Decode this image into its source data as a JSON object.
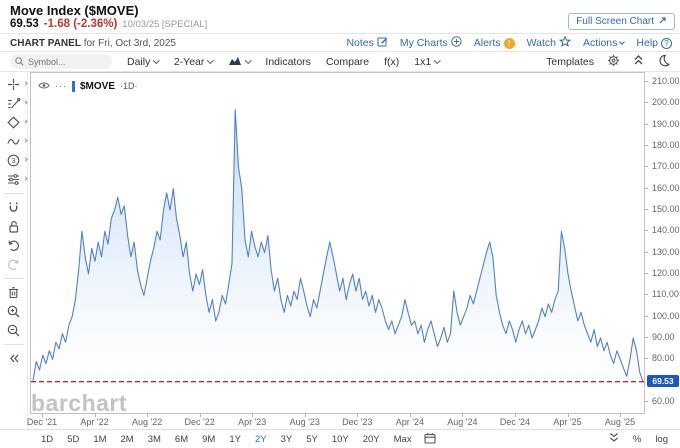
{
  "header": {
    "title": "Move Index ($MOVE)",
    "quote": {
      "last": "69.53",
      "change": "-1.68 (-2.36%)",
      "date": "10/03/25 [SPECIAL]"
    },
    "fullscreen_button": "Full Screen Chart",
    "panel_label": "CHART PANEL",
    "panel_date": "for Fri, Oct 3rd, 2025",
    "links": [
      {
        "label": "Notes",
        "icon": "edit-note-icon"
      },
      {
        "label": "My Charts",
        "icon": "circle-plus-icon"
      },
      {
        "label": "Alerts",
        "icon": "alert-badge-icon"
      },
      {
        "label": "Watch",
        "icon": "star-icon"
      },
      {
        "label": "Actions",
        "icon": "caret-down-icon"
      },
      {
        "label": "Help",
        "icon": "question-circle-icon"
      }
    ]
  },
  "toolbar": {
    "symbol_placeholder": "Symbol...",
    "period_label": "Daily",
    "range_label": "2-Year",
    "chart_type_icon": "area-chart-icon",
    "items": [
      "Indicators",
      "Compare",
      "f(x)",
      "1x1"
    ],
    "templates_label": "Templates",
    "right_icons": [
      "gear-icon",
      "collapse-up-icon",
      "moon-icon"
    ]
  },
  "sidebar_tools": [
    "cursor-crosshair",
    "trend-line",
    "shapes",
    "wave",
    "annotation-3",
    "sliders",
    "magnet",
    "unlock",
    "undo",
    "redo",
    "trash",
    "zoom-in",
    "zoom-out",
    "collapse-left"
  ],
  "chart": {
    "legend_symbol": "$MOVE",
    "legend_period": "·1D·",
    "last_price_badge": "69.53",
    "watermark": "barchart"
  },
  "chart_data": {
    "type": "area",
    "title": "Move Index ($MOVE), Daily, 2-Year view ending Fri Oct 3rd 2025",
    "symbol": "$MOVE",
    "timeframe": "Daily",
    "range": "2-Year",
    "x_start": "Dec 2021",
    "x_end": "Oct 3, 2025",
    "x_tick_labels": [
      "Dec '21",
      "Apr '22",
      "Aug '22",
      "Dec '22",
      "Apr '23",
      "Aug '23",
      "Dec '23",
      "Apr '24",
      "Aug '24",
      "Dec '24",
      "Apr '25",
      "Aug '25"
    ],
    "y_ticks": [
      210,
      200,
      190,
      180,
      170,
      160,
      150,
      140,
      130,
      120,
      110,
      100,
      90,
      80,
      60
    ],
    "ylim": [
      55,
      215
    ],
    "grid": false,
    "legend_position": "top-left",
    "last_value": 69.53,
    "reference_line": {
      "value": 69.53,
      "style": "dashed",
      "color": "#cc2b2b"
    },
    "values": [
      70,
      79,
      75,
      82,
      78,
      84,
      80,
      88,
      85,
      92,
      88,
      96,
      100,
      108,
      122,
      140,
      128,
      120,
      132,
      126,
      135,
      128,
      140,
      134,
      146,
      150,
      156,
      148,
      152,
      138,
      128,
      135,
      122,
      115,
      110,
      118,
      126,
      132,
      140,
      136,
      150,
      158,
      150,
      160,
      146,
      138,
      128,
      135,
      120,
      112,
      120,
      115,
      122,
      110,
      102,
      108,
      98,
      102,
      110,
      106,
      115,
      125,
      197,
      170,
      160,
      136,
      128,
      140,
      133,
      128,
      135,
      130,
      138,
      122,
      112,
      118,
      108,
      102,
      110,
      105,
      112,
      108,
      118,
      112,
      105,
      100,
      108,
      104,
      112,
      120,
      128,
      135,
      128,
      120,
      112,
      118,
      108,
      115,
      120,
      112,
      118,
      108,
      112,
      105,
      110,
      102,
      108,
      104,
      98,
      94,
      98,
      92,
      96,
      100,
      108,
      102,
      96,
      98,
      92,
      96,
      88,
      94,
      98,
      92,
      86,
      90,
      95,
      88,
      92,
      112,
      102,
      96,
      100,
      104,
      110,
      106,
      112,
      118,
      124,
      130,
      135,
      128,
      110,
      102,
      96,
      92,
      98,
      94,
      88,
      94,
      98,
      92,
      96,
      90,
      94,
      98,
      104,
      100,
      106,
      102,
      108,
      112,
      140,
      132,
      120,
      112,
      105,
      98,
      102,
      96,
      92,
      88,
      94,
      86,
      90,
      84,
      88,
      82,
      78,
      84,
      80,
      76,
      72,
      80,
      90,
      84,
      74,
      69.53
    ]
  },
  "bottom_bar": {
    "ranges": [
      "1D",
      "5D",
      "1M",
      "2M",
      "3M",
      "6M",
      "9M",
      "1Y",
      "2Y",
      "3Y",
      "5Y",
      "10Y",
      "20Y",
      "Max"
    ],
    "active": "2Y",
    "scale_buttons": [
      "%",
      "log"
    ]
  },
  "colors": {
    "series_line": "#4d82d4",
    "series_fill_top": "#a9c8ee",
    "accent_blue": "#2e6cb5",
    "active_range_blue": "#2e6fdb",
    "negative_red": "#c0392b",
    "reference_red": "#cc2b2b",
    "badge_bg": "#1b57c4",
    "alert_badge_orange": "#f5a623",
    "frame_border": "#cdb9da"
  }
}
